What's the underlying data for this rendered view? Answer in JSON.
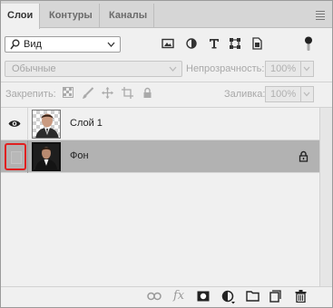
{
  "tabs": [
    {
      "label": "Слои",
      "active": true
    },
    {
      "label": "Контуры",
      "active": false
    },
    {
      "label": "Каналы",
      "active": false
    }
  ],
  "filter": {
    "kind_value": "Вид",
    "icons": [
      "image-filter-icon",
      "adjustment-filter-icon",
      "type-filter-icon",
      "shape-filter-icon",
      "smart-object-filter-icon"
    ]
  },
  "blend": {
    "mode_value": "Обычные",
    "opacity_label": "Непрозрачность:",
    "opacity_value": "100%"
  },
  "lock": {
    "label": "Закрепить:",
    "fill_label": "Заливка:",
    "fill_value": "100%"
  },
  "layers": [
    {
      "name": "Слой 1",
      "visible": true,
      "selected": false,
      "locked": false
    },
    {
      "name": "Фон",
      "visible": false,
      "selected": true,
      "locked": true
    }
  ],
  "colors": {
    "accent_highlight": "#e02020",
    "selected_row": "#b2b2b2",
    "panel_bg": "#f0f0f0"
  },
  "bottom_icons": [
    "link-layers-icon",
    "fx-icon",
    "add-mask-icon",
    "new-adjustment-icon",
    "new-group-icon",
    "new-layer-icon",
    "delete-layer-icon"
  ],
  "bottom": {
    "fx_label": "fx"
  }
}
